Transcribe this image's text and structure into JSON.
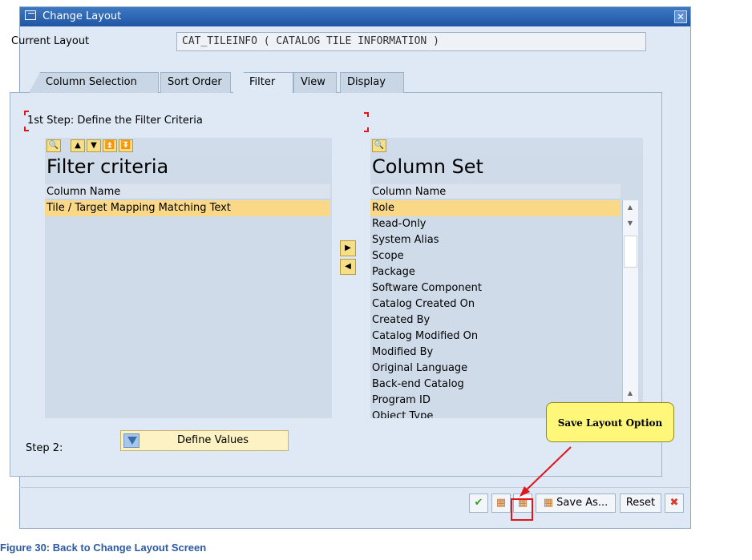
{
  "window": {
    "title": "Change Layout",
    "close_icon": "close-icon"
  },
  "current_layout": {
    "label": "Current Layout",
    "value": "CAT_TILEINFO ( CATALOG TILE INFORMATION )"
  },
  "tabs": [
    {
      "label": "Column Selection",
      "active": false
    },
    {
      "label": "Sort Order",
      "active": false
    },
    {
      "label": "Filter",
      "active": true
    },
    {
      "label": "View",
      "active": false
    },
    {
      "label": "Display",
      "active": false
    }
  ],
  "step1": {
    "label": "1st Step: Define the Filter Criteria"
  },
  "filter_criteria": {
    "heading": "Filter criteria",
    "column_header": "Column Name",
    "items": [
      "Tile / Target Mapping Matching Text"
    ],
    "toolbar_icons": [
      "binoculars-icon",
      "up-arrow-icon",
      "down-arrow-icon",
      "top-icon",
      "bottom-icon"
    ]
  },
  "column_set": {
    "heading": "Column Set",
    "column_header": "Column Name",
    "items": [
      "Role",
      "Read-Only",
      "System Alias",
      "Scope",
      "Package",
      "Software Component",
      "Catalog Created On",
      "Created By",
      "Catalog Modified On",
      "Modified By",
      "Original Language",
      "Back-end Catalog",
      "Program ID",
      "Object Type"
    ],
    "selected_index": 0
  },
  "step2": {
    "label": "Step 2:",
    "button_label": "Define Values"
  },
  "bottom_bar": {
    "save_as_label": "Save As...",
    "reset_label": "Reset"
  },
  "callout": {
    "text": "Save Layout Option"
  },
  "caption": "Figure 30: Back to Change Layout Screen",
  "colors": {
    "title_bar": "#1f56a3",
    "selection": "#f9d987",
    "callout": "#fff77a",
    "highlight": "#e0161c"
  }
}
